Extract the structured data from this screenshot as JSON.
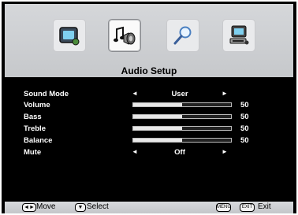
{
  "tabs": [
    {
      "name": "picture",
      "icon": "picture-icon"
    },
    {
      "name": "audio",
      "icon": "music-note-speaker-icon",
      "selected": true
    },
    {
      "name": "search",
      "icon": "magnifier-icon"
    },
    {
      "name": "setup",
      "icon": "computer-setup-icon"
    }
  ],
  "page_title": "Audio Setup",
  "menu": [
    {
      "label": "Sound Mode",
      "type": "option",
      "value": "User"
    },
    {
      "label": "Volume",
      "type": "slider",
      "value": 50,
      "max": 100
    },
    {
      "label": "Bass",
      "type": "slider",
      "value": 50,
      "max": 100
    },
    {
      "label": "Treble",
      "type": "slider",
      "value": 50,
      "max": 100
    },
    {
      "label": "Balance",
      "type": "slider",
      "value": 50,
      "max": 100
    },
    {
      "label": "Mute",
      "type": "option",
      "value": "Off"
    }
  ],
  "footer": {
    "move_key": "◄►",
    "move_label": "Move",
    "select_key": "▼",
    "select_label": "Select",
    "menu_key": "MENU",
    "exit_key": "EXIT",
    "exit_label": "Exit"
  },
  "colors": {
    "panel": "#c8cacd",
    "background": "#000000",
    "text": "#ffffff"
  }
}
